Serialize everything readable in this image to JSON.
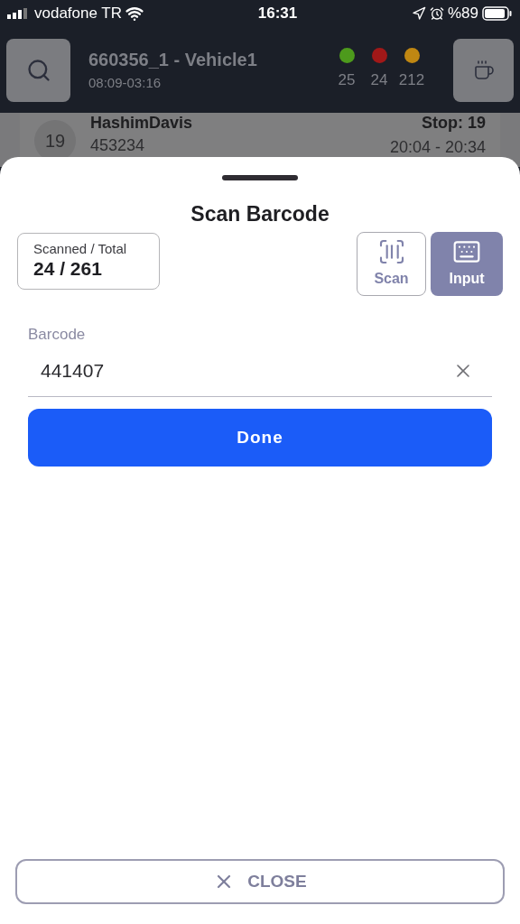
{
  "status_bar": {
    "carrier": "vodafone TR",
    "time": "16:31",
    "battery": "%89"
  },
  "header": {
    "title": "660356_1 - Vehicle1",
    "subtitle": "08:09-03:16",
    "counters": [
      {
        "value": "25",
        "color": "#4d9a1c"
      },
      {
        "value": "24",
        "color": "#a11818"
      },
      {
        "value": "212",
        "color": "#c08712"
      }
    ]
  },
  "stop_row": {
    "number": "19",
    "name": "HashimDavis",
    "code": "453234",
    "stop": "Stop: 19",
    "time_window": "20:04 - 20:34"
  },
  "sheet": {
    "title": "Scan Barcode",
    "counter_label": "Scanned / Total",
    "counter_value": "24 / 261",
    "modes": [
      {
        "kind": "scan",
        "label": "Scan",
        "selected": false
      },
      {
        "kind": "input",
        "label": "Input",
        "selected": true
      }
    ],
    "field": {
      "label": "Barcode",
      "value": "441407"
    },
    "done_button": "Done",
    "close_button": "CLOSE"
  }
}
